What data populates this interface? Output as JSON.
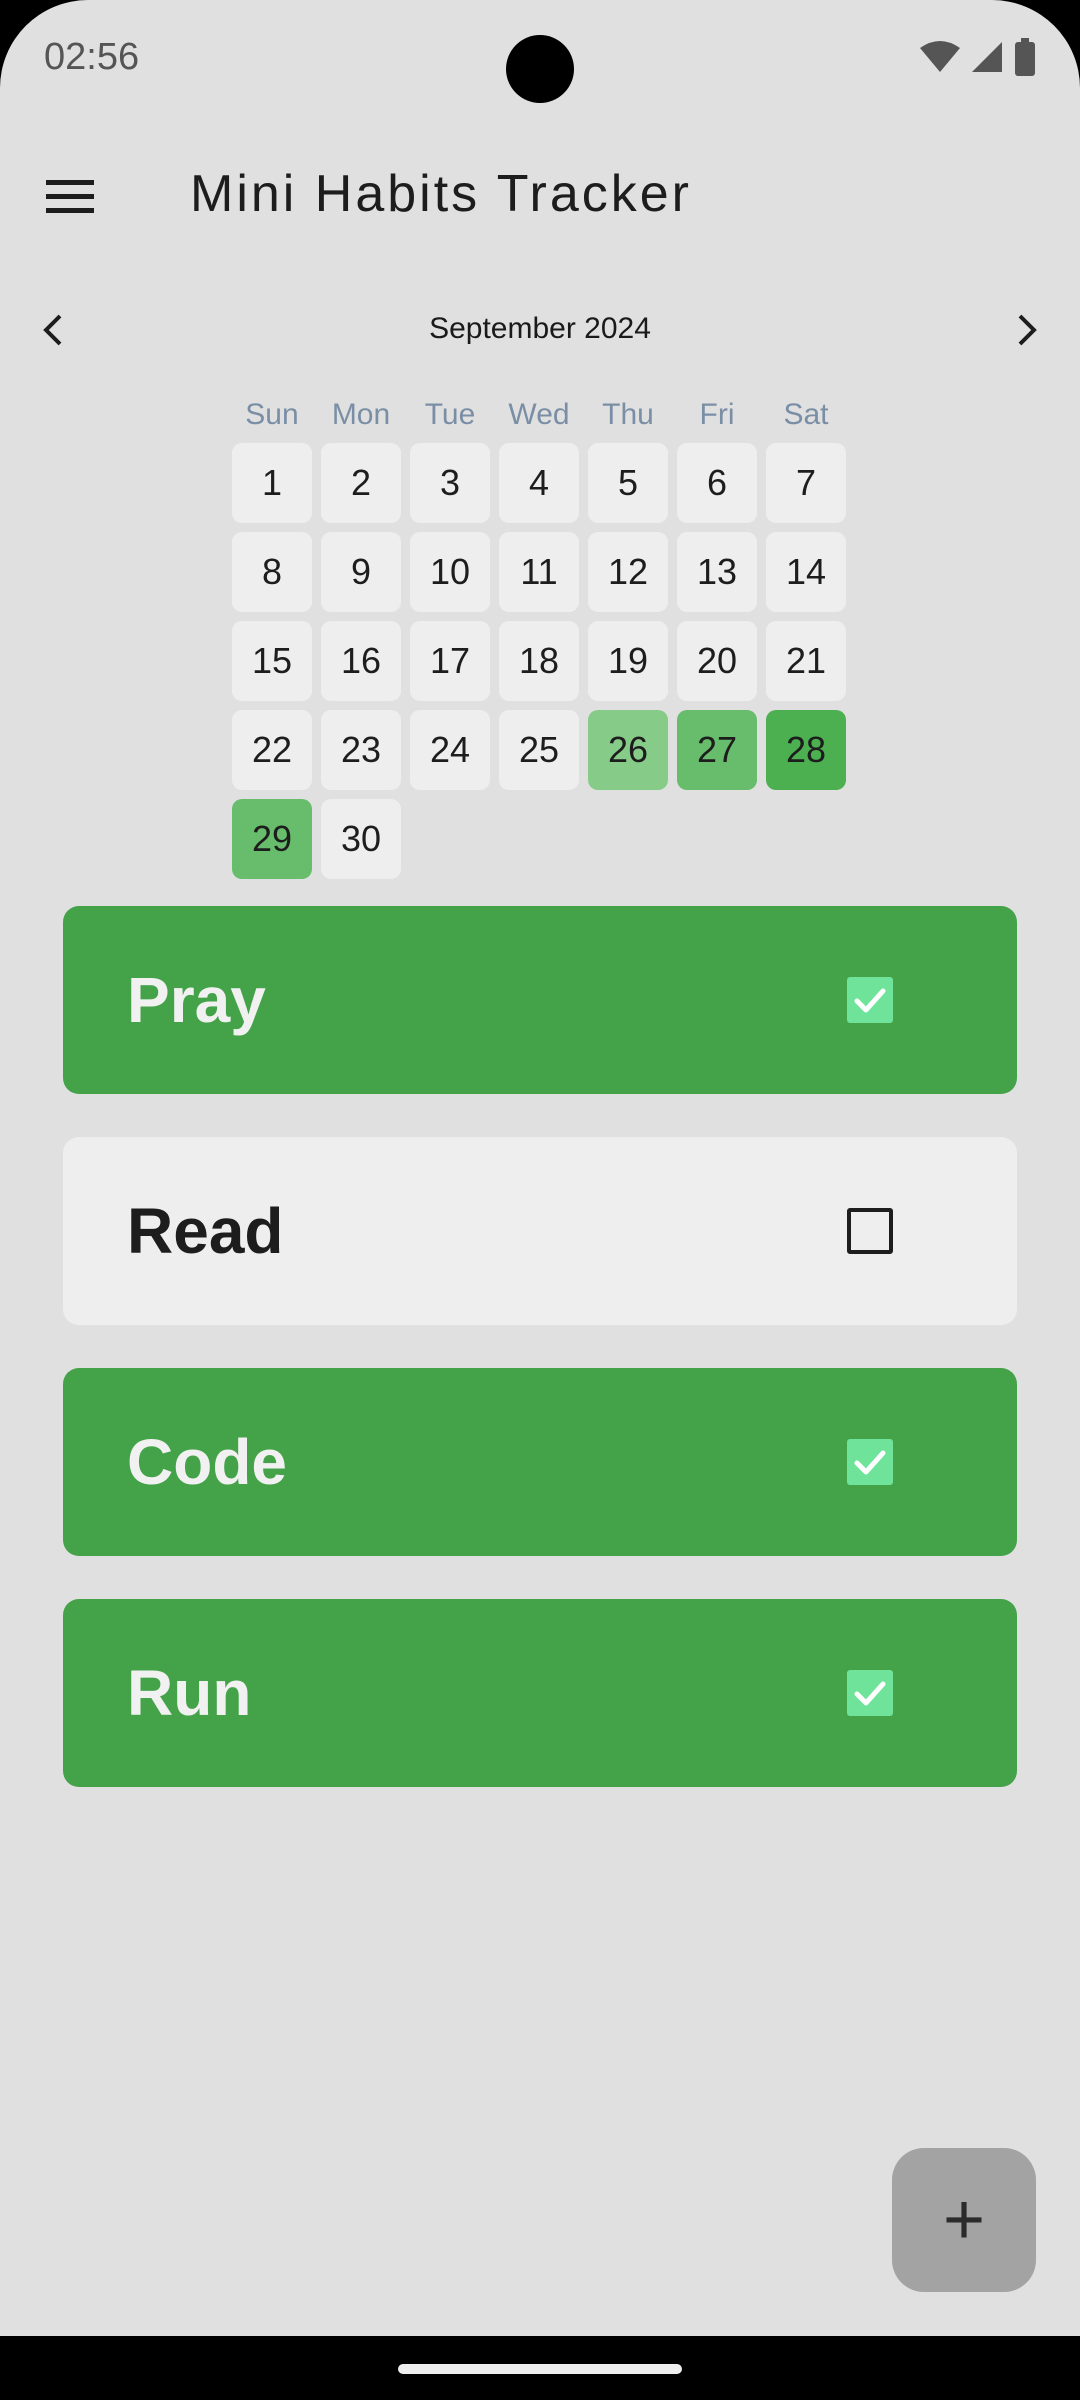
{
  "status_bar": {
    "time": "02:56"
  },
  "app_bar": {
    "title": "Mini Habits Tracker"
  },
  "calendar": {
    "month_title": "September 2024",
    "weekdays": [
      "Sun",
      "Mon",
      "Tue",
      "Wed",
      "Thu",
      "Fri",
      "Sat"
    ],
    "days": [
      {
        "label": "1"
      },
      {
        "label": "2"
      },
      {
        "label": "3"
      },
      {
        "label": "4"
      },
      {
        "label": "5"
      },
      {
        "label": "6"
      },
      {
        "label": "7"
      },
      {
        "label": "8"
      },
      {
        "label": "9"
      },
      {
        "label": "10"
      },
      {
        "label": "11"
      },
      {
        "label": "12"
      },
      {
        "label": "13"
      },
      {
        "label": "14"
      },
      {
        "label": "15"
      },
      {
        "label": "16"
      },
      {
        "label": "17"
      },
      {
        "label": "18"
      },
      {
        "label": "19"
      },
      {
        "label": "20"
      },
      {
        "label": "21"
      },
      {
        "label": "22"
      },
      {
        "label": "23"
      },
      {
        "label": "24"
      },
      {
        "label": "25"
      },
      {
        "label": "26",
        "color": "#86cc88"
      },
      {
        "label": "27",
        "color": "#67bd6b"
      },
      {
        "label": "28",
        "color": "#4caf50"
      },
      {
        "label": "29",
        "color": "#67bd6b"
      },
      {
        "label": "30"
      }
    ]
  },
  "habits": [
    {
      "name": "Pray",
      "done": true
    },
    {
      "name": "Read",
      "done": false
    },
    {
      "name": "Code",
      "done": true
    },
    {
      "name": "Run",
      "done": true
    }
  ],
  "colors": {
    "habit_done": "#44a349",
    "habit_pending": "#eeeeee",
    "check_fill": "#6fe39a",
    "day_default": "#eeeeee"
  },
  "icons": {
    "menu": "hamburger-menu-icon",
    "prev": "chevron-left-icon",
    "next": "chevron-right-icon",
    "fab": "plus-icon"
  },
  "fab": {
    "label": "+"
  }
}
